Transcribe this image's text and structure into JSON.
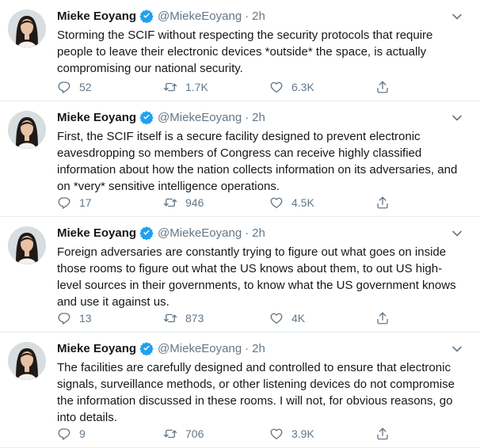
{
  "tweets": [
    {
      "name": "Mieke Eoyang",
      "handle": "@MiekeEoyang",
      "separator": "·",
      "time": "2h",
      "text": "Storming the SCIF without respecting the security protocols  that require people to leave their electronic devices *outside* the space, is actually compromising our national security.",
      "replies": "52",
      "retweets": "1.7K",
      "likes": "6.3K"
    },
    {
      "name": "Mieke Eoyang",
      "handle": "@MiekeEoyang",
      "separator": "·",
      "time": "2h",
      "text": "First, the SCIF itself is a secure facility designed to prevent electronic eavesdropping so members of Congress can receive highly classified information about how the nation collects information on its adversaries, and on *very* sensitive intelligence operations.",
      "replies": "17",
      "retweets": "946",
      "likes": "4.5K"
    },
    {
      "name": "Mieke Eoyang",
      "handle": "@MiekeEoyang",
      "separator": "·",
      "time": "2h",
      "text": "Foreign adversaries are constantly trying to figure out what goes on inside those rooms to figure out what the US knows about them, to out US high-level sources in their governments, to know what the US government knows and use it against us.",
      "replies": "13",
      "retweets": "873",
      "likes": "4K"
    },
    {
      "name": "Mieke Eoyang",
      "handle": "@MiekeEoyang",
      "separator": "·",
      "time": "2h",
      "text": "The facilities are carefully designed and controlled to ensure that electronic signals, surveillance methods, or other listening devices do not compromise the information discussed in these rooms. I will not, for obvious reasons, go into details.",
      "replies": "9",
      "retweets": "706",
      "likes": "3.9K"
    }
  ],
  "colors": {
    "text": "#14171a",
    "secondary": "#657786",
    "verified": "#1da1f2",
    "border": "#e6ecf0"
  },
  "icons": [
    "verified-badge-icon",
    "chevron-down-icon",
    "reply-icon",
    "retweet-icon",
    "like-icon",
    "share-icon"
  ]
}
